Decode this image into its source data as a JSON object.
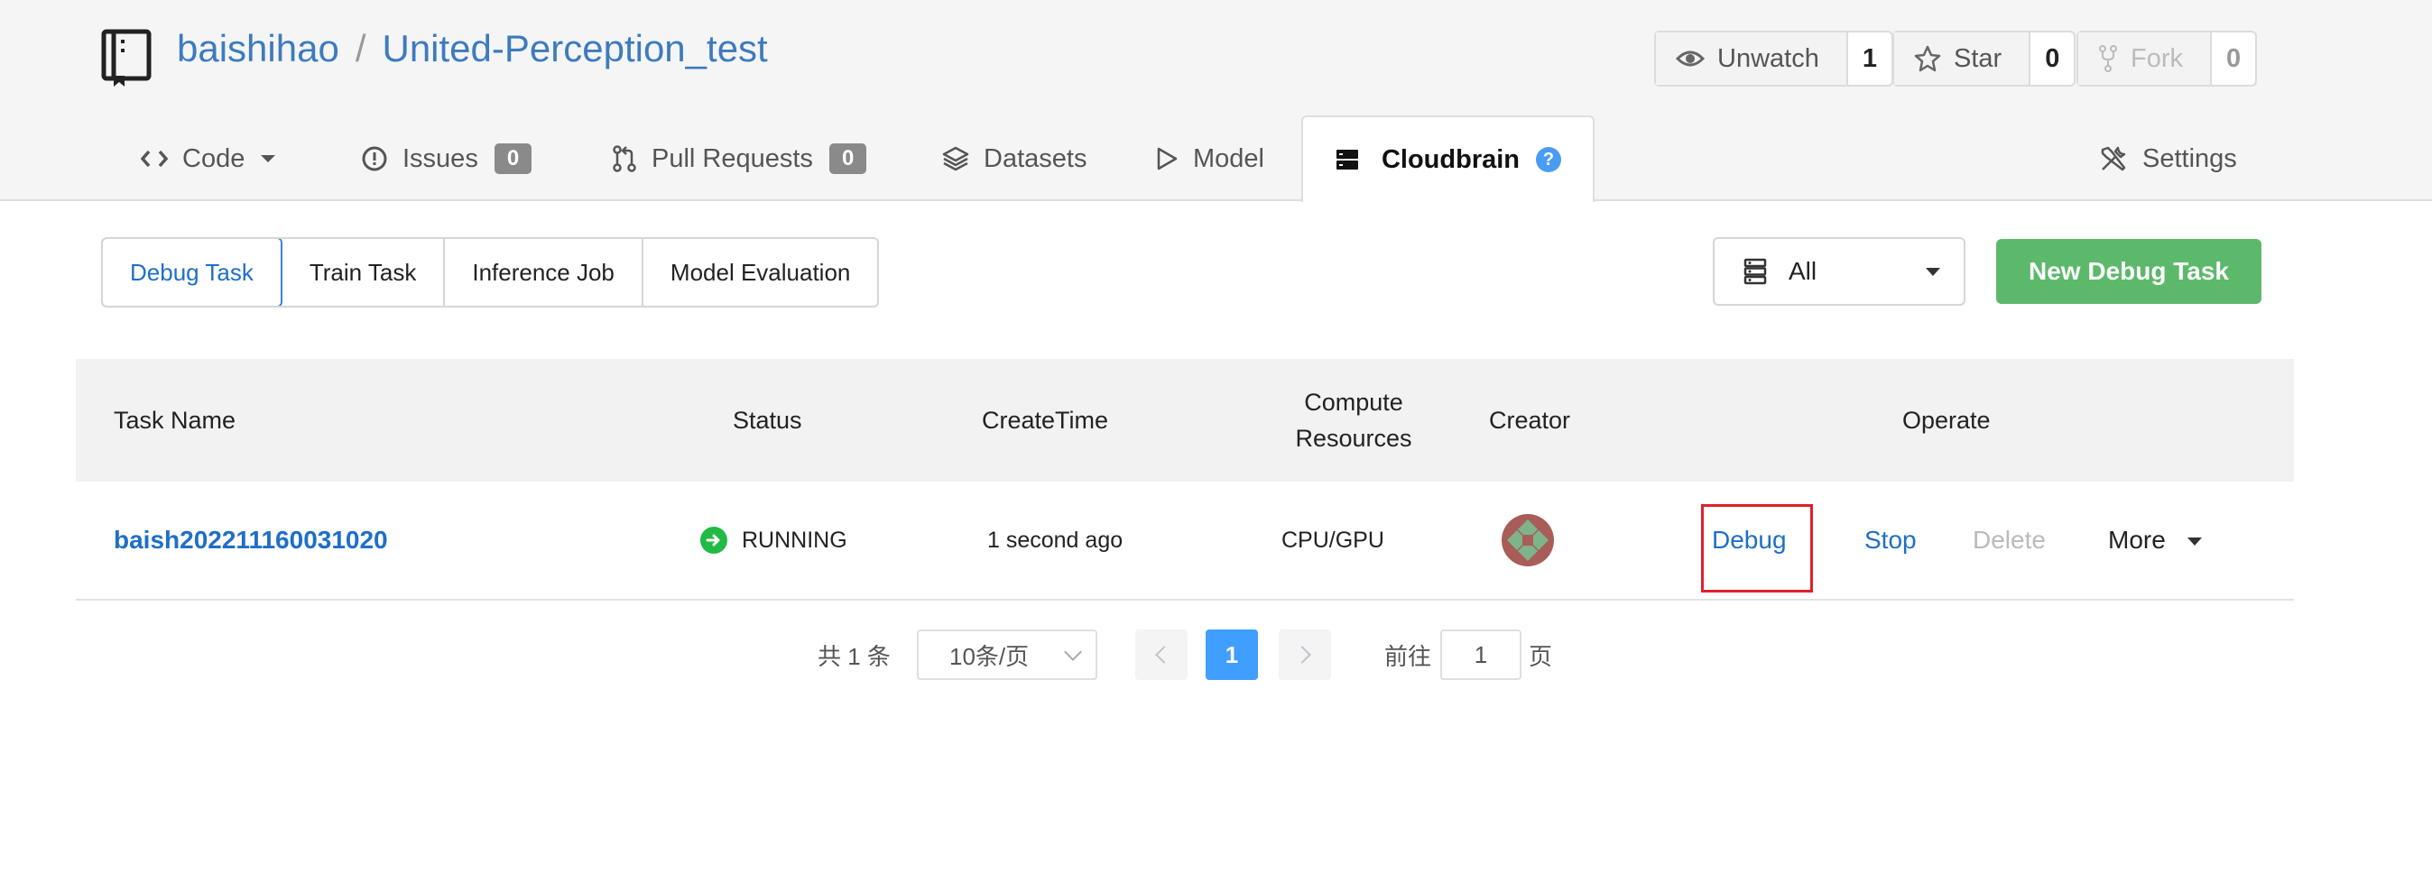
{
  "repo": {
    "owner": "baishihao",
    "separator": "/",
    "name": "United-Perception_test"
  },
  "social": {
    "watch_label": "Unwatch",
    "watch_count": "1",
    "star_label": "Star",
    "star_count": "0",
    "fork_label": "Fork",
    "fork_count": "0"
  },
  "tabs": {
    "code": "Code",
    "issues": "Issues",
    "issues_count": "0",
    "pulls": "Pull Requests",
    "pulls_count": "0",
    "datasets": "Datasets",
    "model": "Model",
    "cloudbrain": "Cloudbrain",
    "help": "?",
    "settings": "Settings"
  },
  "subtabs": [
    "Debug Task",
    "Train Task",
    "Inference Job",
    "Model Evaluation"
  ],
  "filter": {
    "selected": "All"
  },
  "new_button": "New Debug Task",
  "table": {
    "headers": {
      "task_name": "Task Name",
      "status": "Status",
      "create_time": "CreateTime",
      "compute_1": "Compute",
      "compute_2": "Resources",
      "creator": "Creator",
      "operate": "Operate"
    },
    "rows": [
      {
        "task_name": "baish202211160031020",
        "status": "RUNNING",
        "create_time": "1 second ago",
        "compute": "CPU/GPU",
        "ops": {
          "debug": "Debug",
          "stop": "Stop",
          "delete": "Delete",
          "more": "More"
        }
      }
    ]
  },
  "pagination": {
    "total": "共 1 条",
    "page_size": "10条/页",
    "current_page": "1",
    "goto_label": "前往",
    "goto_value": "1",
    "page_suffix": "页"
  },
  "colors": {
    "link": "#1e6fc8",
    "running": "#21ba45",
    "primary_button": "#5cb96b",
    "highlight_box": "#e0202a",
    "pager_active": "#409eff"
  }
}
